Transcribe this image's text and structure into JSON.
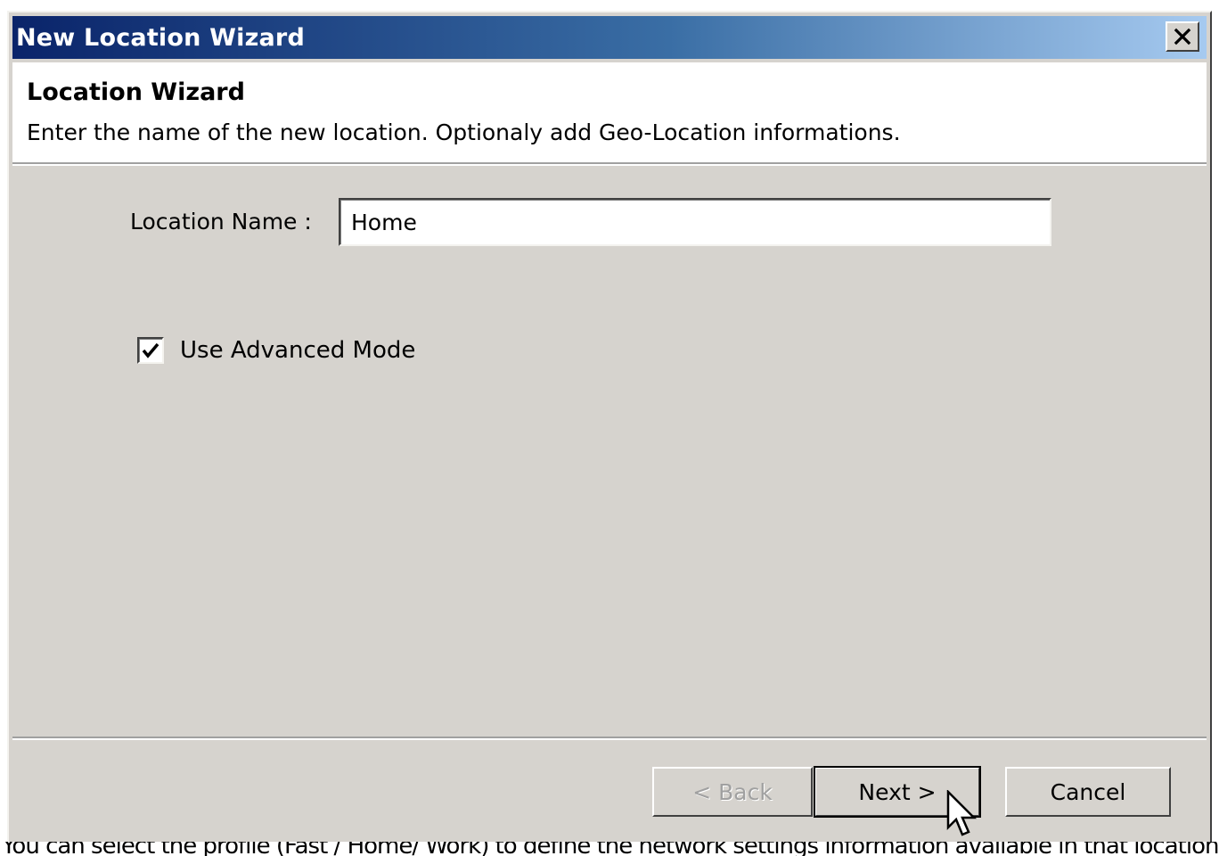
{
  "window": {
    "title": "New Location Wizard",
    "close_icon": "close-icon"
  },
  "header": {
    "title": "Location Wizard",
    "subtitle": "Enter the name of the new location. Optionaly add Geo-Location informations."
  },
  "form": {
    "location_name_label": "Location Name :",
    "location_name_value": "Home",
    "advanced_mode_label": "Use Advanced Mode",
    "advanced_mode_checked": true
  },
  "buttons": {
    "back_label": "< Back",
    "next_label": "Next >",
    "cancel_label": "Cancel"
  },
  "caption": {
    "text": "You can select the profile (Fast / Home/ Work) to define the network settings information available in that location."
  },
  "colors": {
    "titlebar_start": "#0a246a",
    "titlebar_end": "#a6caf0",
    "dialog_background": "#d6d3ce",
    "disabled_text": "#a0a0a0"
  }
}
